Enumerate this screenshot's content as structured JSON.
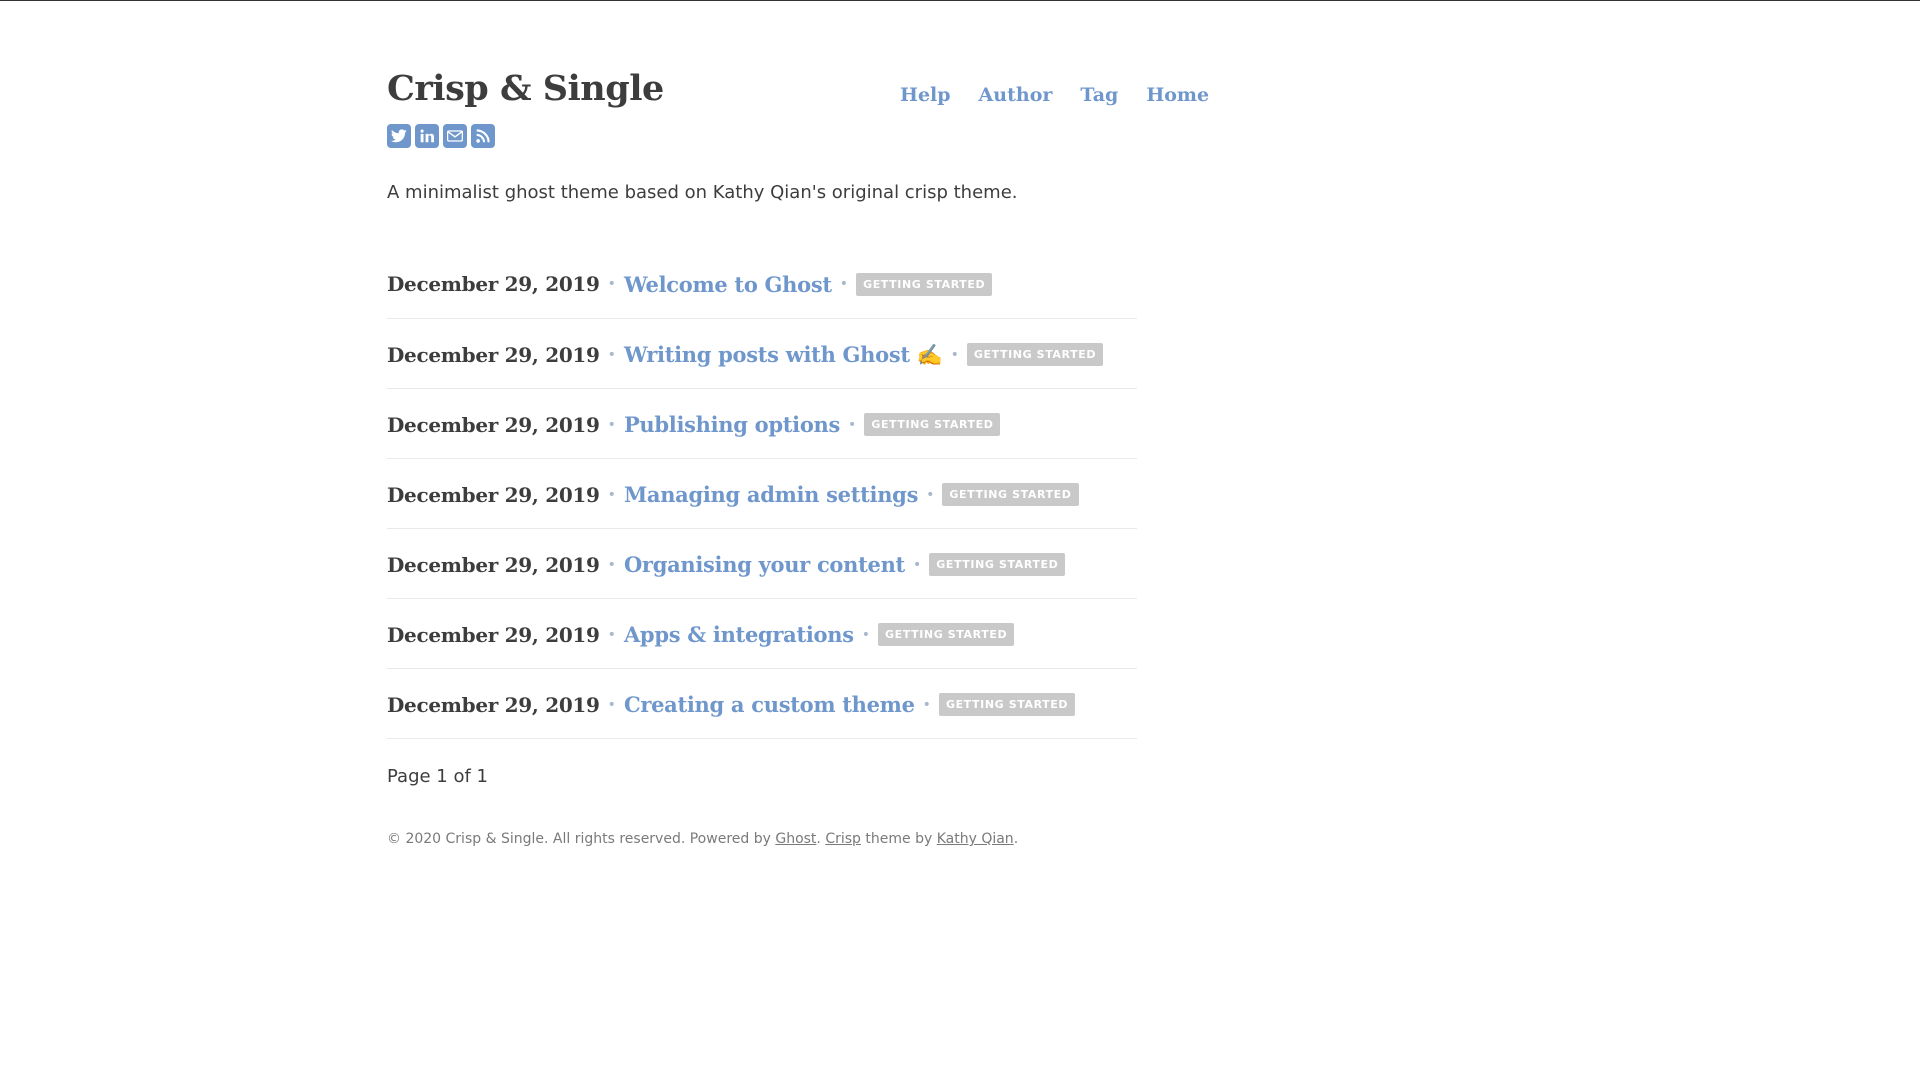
{
  "site": {
    "title": "Crisp & Single",
    "description": "A minimalist ghost theme based on Kathy Qian's original crisp theme."
  },
  "social": [
    "twitter-icon",
    "linkedin-icon",
    "email-icon",
    "rss-icon"
  ],
  "nav": [
    {
      "label": "Help"
    },
    {
      "label": "Author"
    },
    {
      "label": "Tag"
    },
    {
      "label": "Home"
    }
  ],
  "posts": [
    {
      "date": "December 29, 2019",
      "title": "Welcome to Ghost",
      "tag": "GETTING STARTED"
    },
    {
      "date": "December 29, 2019",
      "title": "Writing posts with Ghost ✍️",
      "tag": "GETTING STARTED"
    },
    {
      "date": "December 29, 2019",
      "title": "Publishing options",
      "tag": "GETTING STARTED"
    },
    {
      "date": "December 29, 2019",
      "title": "Managing admin settings",
      "tag": "GETTING STARTED"
    },
    {
      "date": "December 29, 2019",
      "title": "Organising your content",
      "tag": "GETTING STARTED"
    },
    {
      "date": "December 29, 2019",
      "title": "Apps & integrations",
      "tag": "GETTING STARTED"
    },
    {
      "date": "December 29, 2019",
      "title": "Creating a custom theme",
      "tag": "GETTING STARTED"
    }
  ],
  "pagination": "Page 1 of 1",
  "footer": {
    "prefix": "© 2020 Crisp & Single. All rights reserved. Powered by",
    "ghost": "Ghost",
    "dot": ".",
    "crisp": "Crisp",
    "theme_by": "theme by",
    "author": "Kathy Qian",
    "end": "."
  },
  "colors": {
    "accent": "#6f97cc",
    "text": "#3d3d3d",
    "tag_bg": "#c9c9c9"
  }
}
